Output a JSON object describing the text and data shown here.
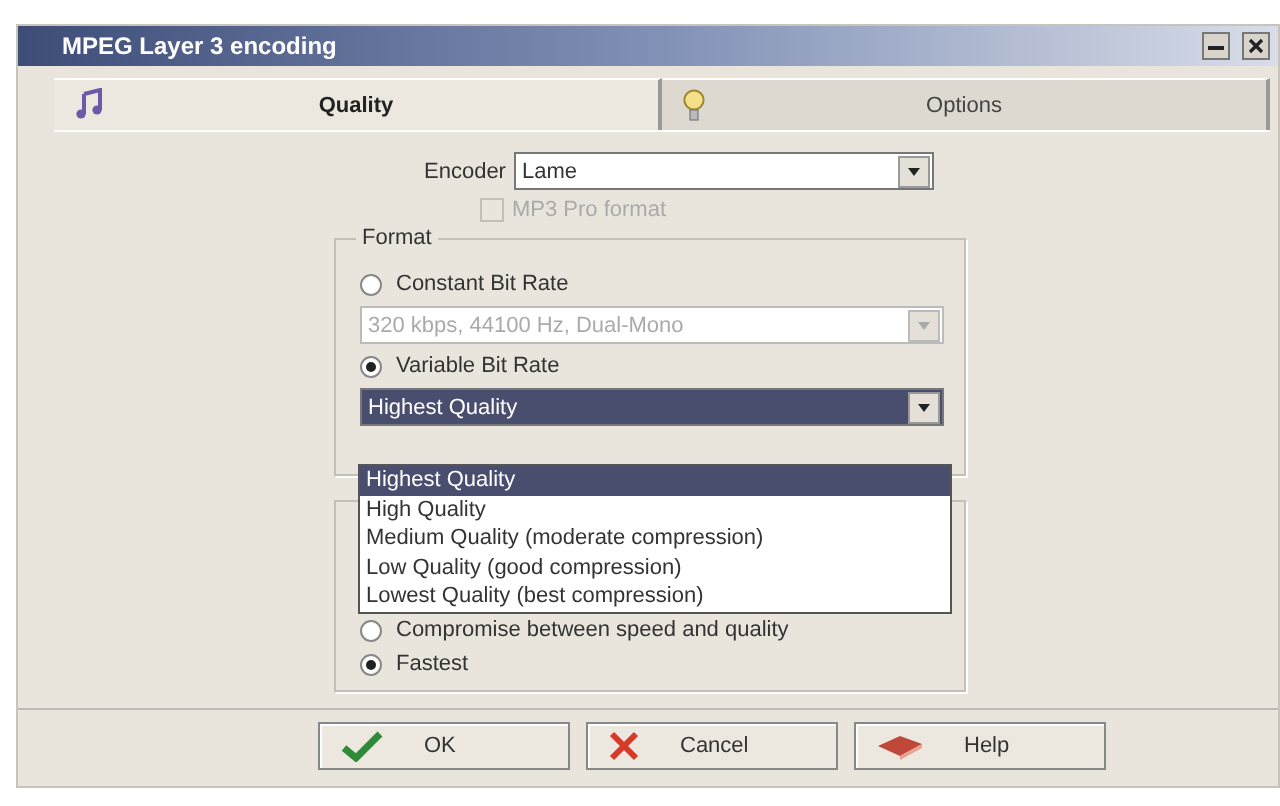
{
  "window": {
    "title": "MPEG Layer 3 encoding"
  },
  "tabs": [
    {
      "label": "Quality",
      "selected": true,
      "kind": "music"
    },
    {
      "label": "Options",
      "selected": false,
      "kind": "bulb"
    }
  ],
  "encoder": {
    "label": "Encoder",
    "value": "Lame"
  },
  "mp3pro": {
    "label": "MP3 Pro format",
    "checked": false,
    "disabled": true
  },
  "format": {
    "legend": "Format",
    "options": [
      {
        "label": "Constant Bit Rate",
        "selected": false
      },
      {
        "label": "Variable Bit Rate",
        "selected": true
      }
    ],
    "cbr_select": {
      "value": "320 kbps, 44100 Hz, Dual-Mono",
      "disabled": true
    },
    "vbr_select": {
      "value": "Highest Quality",
      "disabled": false
    },
    "vbr_list": [
      {
        "label": "Highest Quality",
        "selected": true
      },
      {
        "label": "High Quality",
        "selected": false
      },
      {
        "label": "Medium Quality (moderate compression)",
        "selected": false
      },
      {
        "label": "Low Quality (good compression)",
        "selected": false
      },
      {
        "label": "Lowest Quality (best compression)",
        "selected": false
      }
    ]
  },
  "speed": {
    "options": [
      {
        "label": "Compromise between speed and quality",
        "selected": false
      },
      {
        "label": "Fastest",
        "selected": true
      }
    ]
  },
  "buttons": [
    {
      "label": "OK",
      "kind": "ok"
    },
    {
      "label": "Cancel",
      "kind": "cancel"
    },
    {
      "label": "Help",
      "kind": "help"
    }
  ]
}
